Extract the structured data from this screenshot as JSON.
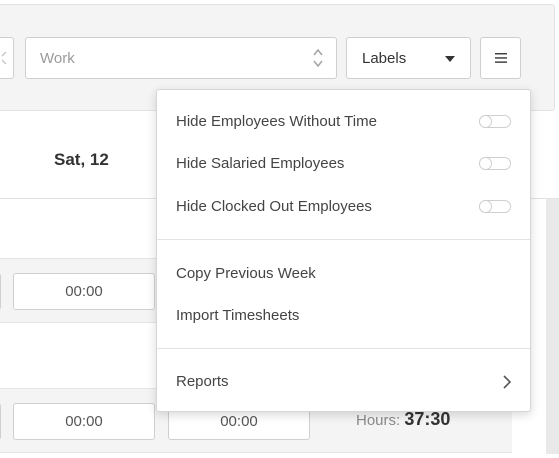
{
  "toolbar": {
    "work_select": {
      "value": "Work",
      "icon": "updown-chevron-icon"
    },
    "labels_select": {
      "value": "Labels",
      "icon": "caret-down-icon"
    },
    "menu_button": {
      "icon": "hamburger-icon"
    }
  },
  "timesheet": {
    "day_label": "Sat, 12",
    "rows": [
      {
        "inputs": [
          "00:00"
        ]
      },
      {
        "inputs": [
          "00:00",
          "00:00"
        ],
        "hours_label": "Hours:",
        "hours_value": "37:30"
      }
    ]
  },
  "dropdown": {
    "toggles": [
      {
        "label": "Hide Employees Without Time",
        "on": false
      },
      {
        "label": "Hide Salaried Employees",
        "on": false
      },
      {
        "label": "Hide Clocked Out Employees",
        "on": false
      }
    ],
    "actions": [
      {
        "label": "Copy Previous Week"
      },
      {
        "label": "Import Timesheets"
      }
    ],
    "submenu": {
      "label": "Reports",
      "icon": "chevron-right-icon"
    }
  },
  "colors": {
    "band_bg": "#f4f4f4",
    "border": "#cfcfcf",
    "text": "#333333",
    "muted": "#8a8a8a"
  }
}
